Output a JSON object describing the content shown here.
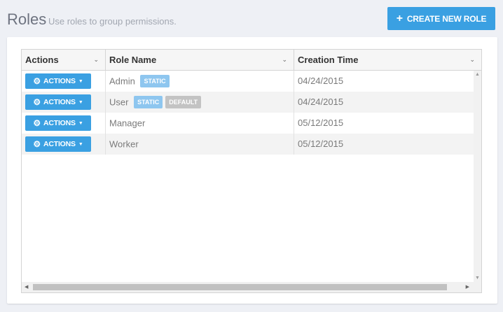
{
  "header": {
    "title": "Roles",
    "subtitle": "Use roles to group permissions.",
    "create_button": {
      "icon": "plus-icon",
      "label": "CREATE NEW ROLE"
    }
  },
  "table": {
    "columns": [
      "Actions",
      "Role Name",
      "Creation Time"
    ],
    "actions_label": "ACTIONS",
    "rows": [
      {
        "role": "Admin",
        "badges": [
          "STATIC"
        ],
        "created": "04/24/2015"
      },
      {
        "role": "User",
        "badges": [
          "STATIC",
          "DEFAULT"
        ],
        "created": "04/24/2015"
      },
      {
        "role": "Manager",
        "badges": [],
        "created": "05/12/2015"
      },
      {
        "role": "Worker",
        "badges": [],
        "created": "05/12/2015"
      }
    ]
  },
  "colors": {
    "primary": "#3aa0e2",
    "badge_static": "#8ec6ef",
    "badge_default": "#c3c3c3",
    "background": "#eef0f5"
  }
}
